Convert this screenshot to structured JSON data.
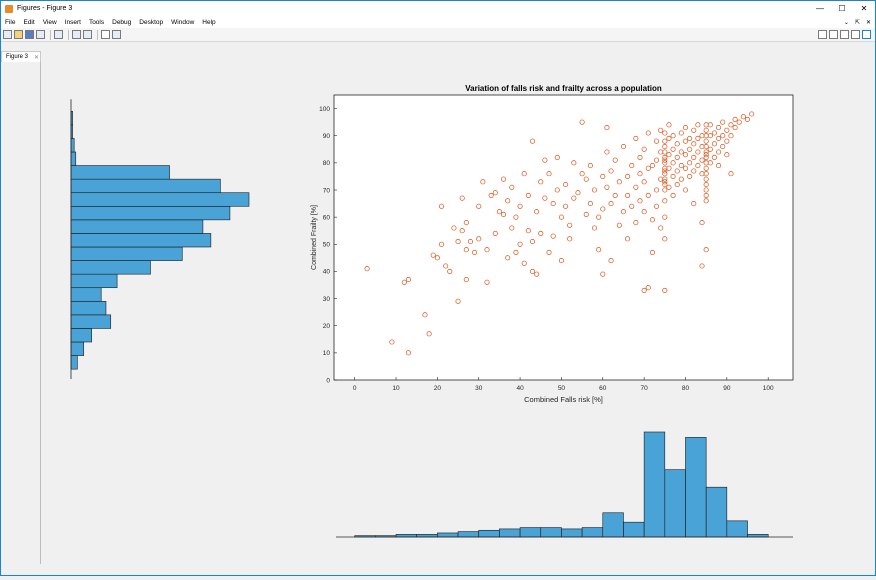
{
  "window": {
    "title": "Figures - Figure 3",
    "controls": {
      "minimize": "—",
      "maximize": "☐",
      "close": "✕"
    }
  },
  "menu": {
    "items": [
      "File",
      "Edit",
      "View",
      "Insert",
      "Tools",
      "Debug",
      "Desktop",
      "Window",
      "Help"
    ],
    "right": [
      "⌄",
      "⇱",
      "✕"
    ]
  },
  "tab": {
    "label": "Figure 3",
    "close": "✕"
  },
  "chart_data": [
    {
      "type": "scatter",
      "title": "Variation of falls risk and frailty across a population",
      "xlabel": "Combined Falls risk [%]",
      "ylabel": "Combined Frailty [%]",
      "xlim": [
        -5,
        106
      ],
      "ylim": [
        0,
        105
      ],
      "xticks": [
        0,
        10,
        20,
        30,
        40,
        50,
        60,
        70,
        80,
        90,
        100
      ],
      "yticks": [
        0,
        10,
        20,
        30,
        40,
        50,
        60,
        70,
        80,
        90,
        100
      ],
      "marker_color": "#d95319",
      "points": [
        [
          3,
          41
        ],
        [
          9,
          14
        ],
        [
          13,
          10
        ],
        [
          12,
          36
        ],
        [
          13,
          37
        ],
        [
          17,
          24
        ],
        [
          18,
          17
        ],
        [
          19,
          46
        ],
        [
          20,
          45
        ],
        [
          21,
          50
        ],
        [
          21,
          64
        ],
        [
          22,
          42
        ],
        [
          23,
          40
        ],
        [
          24,
          56
        ],
        [
          25,
          29
        ],
        [
          25,
          51
        ],
        [
          26,
          55
        ],
        [
          26,
          67
        ],
        [
          27,
          37
        ],
        [
          27,
          48
        ],
        [
          27,
          58
        ],
        [
          28,
          51
        ],
        [
          29,
          47
        ],
        [
          30,
          52
        ],
        [
          30,
          64
        ],
        [
          31,
          73
        ],
        [
          32,
          36
        ],
        [
          32,
          48
        ],
        [
          33,
          68
        ],
        [
          34,
          54
        ],
        [
          34,
          69
        ],
        [
          35,
          62
        ],
        [
          36,
          61
        ],
        [
          36,
          74
        ],
        [
          37,
          45
        ],
        [
          37,
          66
        ],
        [
          38,
          71
        ],
        [
          38,
          56
        ],
        [
          39,
          60
        ],
        [
          39,
          47
        ],
        [
          40,
          50
        ],
        [
          40,
          64
        ],
        [
          41,
          76
        ],
        [
          41,
          43
        ],
        [
          42,
          68
        ],
        [
          42,
          55
        ],
        [
          43,
          51
        ],
        [
          43,
          40
        ],
        [
          43,
          88
        ],
        [
          44,
          62
        ],
        [
          44,
          39
        ],
        [
          45,
          73
        ],
        [
          45,
          54
        ],
        [
          46,
          67
        ],
        [
          46,
          81
        ],
        [
          47,
          76
        ],
        [
          47,
          47
        ],
        [
          48,
          65
        ],
        [
          48,
          53
        ],
        [
          49,
          82
        ],
        [
          49,
          70
        ],
        [
          50,
          60
        ],
        [
          50,
          44
        ],
        [
          51,
          64
        ],
        [
          51,
          72
        ],
        [
          52,
          52
        ],
        [
          52,
          57
        ],
        [
          53,
          80
        ],
        [
          53,
          67
        ],
        [
          54,
          69
        ],
        [
          55,
          76
        ],
        [
          55,
          95
        ],
        [
          56,
          61
        ],
        [
          56,
          74
        ],
        [
          57,
          79
        ],
        [
          57,
          65
        ],
        [
          58,
          70
        ],
        [
          58,
          56
        ],
        [
          59,
          48
        ],
        [
          59,
          60
        ],
        [
          60,
          75
        ],
        [
          60,
          63
        ],
        [
          60,
          39
        ],
        [
          61,
          71
        ],
        [
          61,
          84
        ],
        [
          61,
          93
        ],
        [
          62,
          65
        ],
        [
          62,
          44
        ],
        [
          62,
          77
        ],
        [
          63,
          68
        ],
        [
          63,
          81
        ],
        [
          64,
          57
        ],
        [
          64,
          73
        ],
        [
          65,
          62
        ],
        [
          65,
          86
        ],
        [
          66,
          75
        ],
        [
          66,
          68
        ],
        [
          66,
          52
        ],
        [
          67,
          79
        ],
        [
          67,
          64
        ],
        [
          68,
          89
        ],
        [
          68,
          71
        ],
        [
          68,
          58
        ],
        [
          69,
          82
        ],
        [
          69,
          76
        ],
        [
          69,
          66
        ],
        [
          70,
          73
        ],
        [
          70,
          62
        ],
        [
          70,
          85
        ],
        [
          70,
          33
        ],
        [
          71,
          78
        ],
        [
          71,
          91
        ],
        [
          71,
          34
        ],
        [
          71,
          68
        ],
        [
          72,
          79
        ],
        [
          72,
          59
        ],
        [
          72,
          47
        ],
        [
          73,
          81
        ],
        [
          73,
          88
        ],
        [
          73,
          70
        ],
        [
          73,
          64
        ],
        [
          74,
          74
        ],
        [
          74,
          84
        ],
        [
          74,
          92
        ],
        [
          74,
          56
        ],
        [
          75,
          76
        ],
        [
          75,
          72
        ],
        [
          75,
          80
        ],
        [
          75,
          86
        ],
        [
          75,
          66
        ],
        [
          75,
          60
        ],
        [
          75,
          52
        ],
        [
          75,
          33
        ],
        [
          76,
          78
        ],
        [
          76,
          89
        ],
        [
          76,
          71
        ],
        [
          76,
          83
        ],
        [
          76,
          94
        ],
        [
          77,
          80
        ],
        [
          77,
          85
        ],
        [
          77,
          75
        ],
        [
          77,
          68
        ],
        [
          77,
          90
        ],
        [
          78,
          82
        ],
        [
          78,
          77
        ],
        [
          78,
          87
        ],
        [
          78,
          72
        ],
        [
          79,
          84
        ],
        [
          79,
          79
        ],
        [
          79,
          91
        ],
        [
          79,
          74
        ],
        [
          80,
          83
        ],
        [
          80,
          88
        ],
        [
          80,
          78
        ],
        [
          80,
          93
        ],
        [
          80,
          70
        ],
        [
          81,
          85
        ],
        [
          81,
          80
        ],
        [
          81,
          89
        ],
        [
          81,
          75
        ],
        [
          82,
          87
        ],
        [
          82,
          82
        ],
        [
          82,
          92
        ],
        [
          82,
          77
        ],
        [
          82,
          65
        ],
        [
          83,
          84
        ],
        [
          83,
          89
        ],
        [
          83,
          79
        ],
        [
          83,
          94
        ],
        [
          84,
          86
        ],
        [
          84,
          81
        ],
        [
          84,
          90
        ],
        [
          84,
          76
        ],
        [
          84,
          58
        ],
        [
          84,
          42
        ],
        [
          85,
          88
        ],
        [
          85,
          83
        ],
        [
          85,
          92
        ],
        [
          85,
          78
        ],
        [
          85,
          72
        ],
        [
          85,
          68
        ],
        [
          85,
          48
        ],
        [
          86,
          85
        ],
        [
          86,
          90
        ],
        [
          86,
          80
        ],
        [
          86,
          94
        ],
        [
          87,
          87
        ],
        [
          87,
          91
        ],
        [
          87,
          82
        ],
        [
          88,
          89
        ],
        [
          88,
          93
        ],
        [
          88,
          84
        ],
        [
          88,
          79
        ],
        [
          89,
          90
        ],
        [
          89,
          95
        ],
        [
          89,
          86
        ],
        [
          90,
          92
        ],
        [
          90,
          88
        ],
        [
          90,
          83
        ],
        [
          91,
          94
        ],
        [
          91,
          90
        ],
        [
          91,
          76
        ],
        [
          92,
          93
        ],
        [
          92,
          96
        ],
        [
          93,
          95
        ],
        [
          94,
          97
        ],
        [
          95,
          96
        ],
        [
          96,
          98
        ],
        [
          75,
          70
        ],
        [
          75,
          74
        ],
        [
          75,
          78
        ],
        [
          75,
          82
        ],
        [
          75,
          84
        ],
        [
          75,
          88
        ],
        [
          75,
          91
        ],
        [
          75,
          73
        ],
        [
          75,
          77
        ],
        [
          75,
          81
        ],
        [
          85,
          70
        ],
        [
          85,
          74
        ],
        [
          85,
          76
        ],
        [
          85,
          80
        ],
        [
          85,
          82
        ],
        [
          85,
          86
        ],
        [
          85,
          90
        ],
        [
          85,
          94
        ],
        [
          85,
          66
        ],
        [
          85,
          84
        ]
      ]
    },
    {
      "type": "bar",
      "orientation": "horizontal",
      "bin_edges": [
        4,
        9,
        14,
        19,
        24,
        29,
        34,
        39,
        44,
        49,
        54,
        59,
        64,
        69,
        74,
        79,
        84,
        89,
        94,
        99
      ],
      "counts": [
        4,
        8,
        13,
        25,
        22,
        19,
        29,
        50,
        70,
        88,
        83,
        100,
        112,
        94,
        62,
        3,
        2,
        1,
        1
      ],
      "bar_color": "#4aa3d6"
    },
    {
      "type": "bar",
      "orientation": "vertical",
      "bin_edges": [
        0,
        5,
        10,
        15,
        20,
        25,
        30,
        35,
        40,
        45,
        50,
        55,
        60,
        65,
        70,
        75,
        80,
        85,
        90,
        95,
        100
      ],
      "counts": [
        1,
        1,
        2,
        2,
        3,
        4,
        5,
        6,
        7,
        7,
        6,
        7,
        18,
        11,
        78,
        50,
        74,
        37,
        12,
        2
      ],
      "bar_color": "#4aa3d6"
    }
  ]
}
